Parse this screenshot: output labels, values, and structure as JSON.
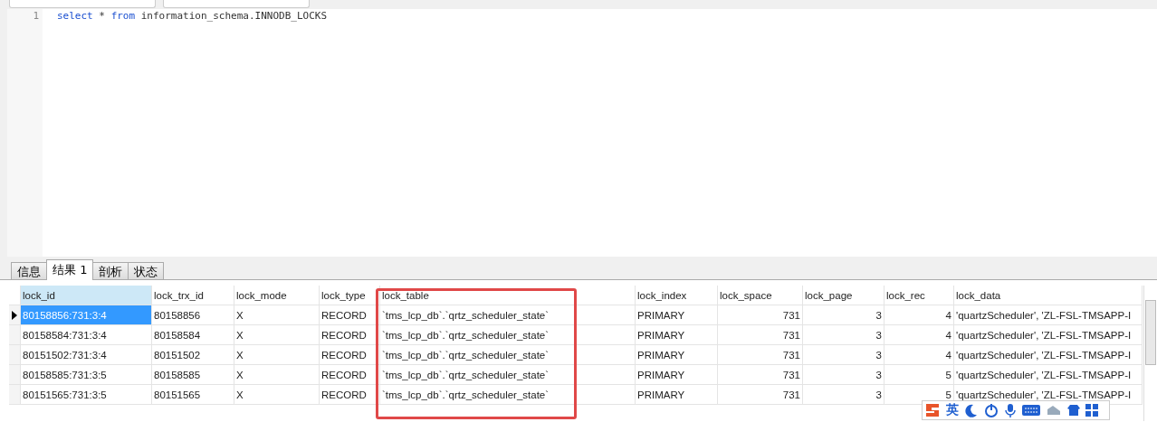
{
  "editor": {
    "lines": [
      {
        "number": "1",
        "tokens": [
          {
            "kind": "keyword",
            "text": "select"
          },
          {
            "kind": "plain",
            "text": " * "
          },
          {
            "kind": "keyword",
            "text": "from"
          },
          {
            "kind": "plain",
            "text": " information_schema.INNODB_LOCKS"
          }
        ]
      }
    ]
  },
  "result_tabs": [
    {
      "label": "信息",
      "selected": false
    },
    {
      "label": "结果 1",
      "selected": true
    },
    {
      "label": "剖析",
      "selected": false
    },
    {
      "label": "状态",
      "selected": false
    }
  ],
  "grid": {
    "columns": [
      {
        "label": "lock_id"
      },
      {
        "label": "lock_trx_id"
      },
      {
        "label": "lock_mode"
      },
      {
        "label": "lock_type"
      },
      {
        "label": "lock_table"
      },
      {
        "label": "lock_index"
      },
      {
        "label": "lock_space"
      },
      {
        "label": "lock_page"
      },
      {
        "label": "lock_rec"
      },
      {
        "label": "lock_data"
      }
    ],
    "rows": [
      {
        "selected": true,
        "cells": [
          "80158856:731:3:4",
          "80158856",
          "X",
          "RECORD",
          "`tms_lcp_db`.`qrtz_scheduler_state`",
          "PRIMARY",
          "731",
          "3",
          "4",
          "'quartzScheduler', 'ZL-FSL-TMSAPP-I"
        ]
      },
      {
        "selected": false,
        "cells": [
          "80158584:731:3:4",
          "80158584",
          "X",
          "RECORD",
          "`tms_lcp_db`.`qrtz_scheduler_state`",
          "PRIMARY",
          "731",
          "3",
          "4",
          "'quartzScheduler', 'ZL-FSL-TMSAPP-I"
        ]
      },
      {
        "selected": false,
        "cells": [
          "80151502:731:3:4",
          "80151502",
          "X",
          "RECORD",
          "`tms_lcp_db`.`qrtz_scheduler_state`",
          "PRIMARY",
          "731",
          "3",
          "4",
          "'quartzScheduler', 'ZL-FSL-TMSAPP-I"
        ]
      },
      {
        "selected": false,
        "cells": [
          "80158585:731:3:5",
          "80158585",
          "X",
          "RECORD",
          "`tms_lcp_db`.`qrtz_scheduler_state`",
          "PRIMARY",
          "731",
          "3",
          "5",
          "'quartzScheduler', 'ZL-FSL-TMSAPP-I"
        ]
      },
      {
        "selected": false,
        "cells": [
          "80151565:731:3:5",
          "80151565",
          "X",
          "RECORD",
          "`tms_lcp_db`.`qrtz_scheduler_state`",
          "PRIMARY",
          "731",
          "3",
          "5",
          "'quartzScheduler', 'ZL-FSL-TMSAPP-I"
        ]
      }
    ]
  },
  "ime_bar": {
    "language": "英"
  }
}
